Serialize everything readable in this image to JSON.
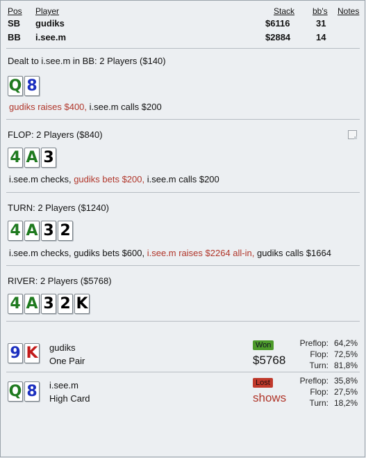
{
  "header": {
    "pos": "Pos",
    "player": "Player",
    "stack": "Stack",
    "bbs": "bb's",
    "notes": "Notes"
  },
  "players": [
    {
      "pos": "SB",
      "name": "gudiks",
      "stack": "$6116",
      "bbs": "31"
    },
    {
      "pos": "BB",
      "name": "i.see.m",
      "stack": "$2884",
      "bbs": "14"
    }
  ],
  "preflop": {
    "title": "Dealt to i.see.m in BB: 2 Players ($140)",
    "cards": [
      {
        "rank": "Q",
        "color": "green"
      },
      {
        "rank": "8",
        "color": "blue"
      }
    ],
    "actions": [
      {
        "text": "gudiks raises $400,",
        "hi": true
      },
      {
        "text": " i.see.m calls $200",
        "hi": false
      }
    ]
  },
  "flop": {
    "title": "FLOP: 2 Players ($840)",
    "cards": [
      {
        "rank": "4",
        "color": "green"
      },
      {
        "rank": "A",
        "color": "green"
      },
      {
        "rank": "3",
        "color": "black"
      }
    ],
    "actions": [
      {
        "text": "i.see.m checks, ",
        "hi": false
      },
      {
        "text": "gudiks bets $200,",
        "hi": true
      },
      {
        "text": " i.see.m calls $200",
        "hi": false
      }
    ]
  },
  "turn": {
    "title": "TURN: 2 Players ($1240)",
    "cards": [
      {
        "rank": "4",
        "color": "green"
      },
      {
        "rank": "A",
        "color": "green"
      },
      {
        "rank": "3",
        "color": "black"
      },
      {
        "rank": "2",
        "color": "black"
      }
    ],
    "actions": [
      {
        "text": "i.see.m checks, gudiks bets $600, ",
        "hi": false
      },
      {
        "text": "i.see.m raises $2264 all-in,",
        "hi": true
      },
      {
        "text": " gudiks calls $1664",
        "hi": false
      }
    ]
  },
  "river": {
    "title": "RIVER: 2 Players ($5768)",
    "cards": [
      {
        "rank": "4",
        "color": "green"
      },
      {
        "rank": "A",
        "color": "green"
      },
      {
        "rank": "3",
        "color": "black"
      },
      {
        "rank": "2",
        "color": "black"
      },
      {
        "rank": "K",
        "color": "black"
      }
    ]
  },
  "results": [
    {
      "cards": [
        {
          "rank": "9",
          "color": "blue"
        },
        {
          "rank": "K",
          "color": "red"
        }
      ],
      "name": "gudiks",
      "hand": "One Pair",
      "badge": "Won",
      "amount": "$5768",
      "stats": [
        {
          "label": "Preflop:",
          "value": "64,2%"
        },
        {
          "label": "Flop:",
          "value": "72,5%"
        },
        {
          "label": "Turn:",
          "value": "81,8%"
        }
      ]
    },
    {
      "cards": [
        {
          "rank": "Q",
          "color": "green"
        },
        {
          "rank": "8",
          "color": "blue"
        }
      ],
      "name": "i.see.m",
      "hand": "High Card",
      "badge": "Lost",
      "amount": "shows",
      "stats": [
        {
          "label": "Preflop:",
          "value": "35,8%"
        },
        {
          "label": "Flop:",
          "value": "27,5%"
        },
        {
          "label": "Turn:",
          "value": "18,2%"
        }
      ]
    }
  ],
  "colors": {
    "highlight": "#b0362a",
    "card_green": "#1f7a1f",
    "card_blue": "#1b2fbf",
    "card_red": "#c21a1a",
    "won": "#4c9a2a",
    "lost": "#c0392b"
  }
}
